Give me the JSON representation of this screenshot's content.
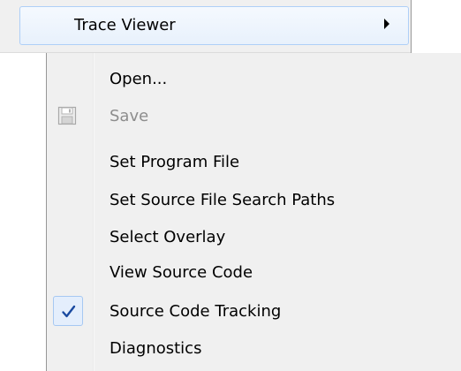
{
  "parent_menu": {
    "item_label": "Trace Viewer",
    "submenu_arrow": "chevron-right-icon"
  },
  "submenu": {
    "items": [
      {
        "label": "Open...",
        "enabled": true,
        "icon": null,
        "checked": false
      },
      {
        "label": "Save",
        "enabled": false,
        "icon": "floppy-disk-icon",
        "checked": false
      },
      {
        "label": "Set Program File",
        "enabled": true,
        "icon": null,
        "checked": false
      },
      {
        "label": "Set Source File Search Paths",
        "enabled": true,
        "icon": null,
        "checked": false
      },
      {
        "label": "Select Overlay",
        "enabled": true,
        "icon": null,
        "checked": false
      },
      {
        "label": "View Source Code",
        "enabled": true,
        "icon": null,
        "checked": false
      },
      {
        "label": "Source Code Tracking",
        "enabled": true,
        "icon": "checkmark-icon",
        "checked": true
      },
      {
        "label": "Diagnostics",
        "enabled": true,
        "icon": null,
        "checked": false
      }
    ]
  },
  "colors": {
    "menu_background": "#f0f0f0",
    "highlight_border": "#aecff7",
    "check_color": "#1a4aa0",
    "disabled_text": "#8d8d8d"
  }
}
